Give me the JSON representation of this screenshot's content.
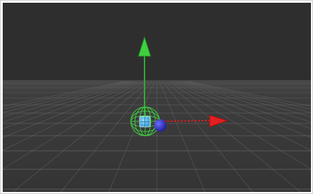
{
  "viewport": {
    "background_color": "#2e2e2e",
    "ground_color": "#3b3b3b",
    "grid_line_color": "#6a6a6a",
    "gizmo": {
      "y_axis_color": "#3fcf3f",
      "x_axis_color": "#e02020",
      "z_handle_color": "#3535c8",
      "sphere_wire_color": "#3fcf3f",
      "center_handle_color": "#6fc3ee",
      "icons": [
        "y-axis-arrow-icon",
        "x-axis-arrow-icon",
        "z-axis-handle-icon",
        "wire-sphere-icon",
        "center-handle-icon"
      ]
    }
  }
}
